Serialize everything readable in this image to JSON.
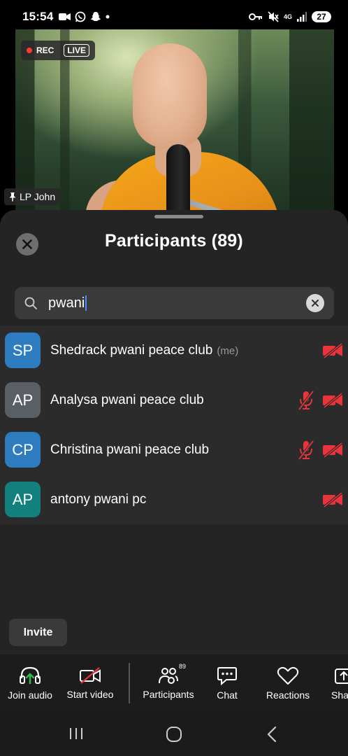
{
  "status_bar": {
    "time": "15:54",
    "network_label": "4G",
    "battery": "27"
  },
  "video": {
    "rec_label": "REC",
    "live_label": "LIVE",
    "speaker_name": "LP John"
  },
  "sheet": {
    "title": "Participants (89)",
    "search": {
      "value": "pwani"
    },
    "participants": [
      {
        "initials": "SP",
        "name": "Shedrack pwani peace club",
        "tag": "(me)",
        "color": "#2d7cbf",
        "mic_muted": false,
        "video_off": true
      },
      {
        "initials": "AP",
        "name": "Analysa pwani peace club",
        "tag": "",
        "color": "#5a5f66",
        "mic_muted": true,
        "video_off": true
      },
      {
        "initials": "CP",
        "name": "Christina pwani peace club",
        "tag": "",
        "color": "#2d7cbf",
        "mic_muted": true,
        "video_off": true
      },
      {
        "initials": "AP",
        "name": "antony pwani pc",
        "tag": "",
        "color": "#12807d",
        "mic_muted": false,
        "video_off": true
      }
    ],
    "invite_label": "Invite"
  },
  "toolbar": {
    "join_audio": "Join audio",
    "start_video": "Start video",
    "participants": "Participants",
    "participants_count": "89",
    "chat": "Chat",
    "reactions": "Reactions",
    "share": "Sha"
  },
  "colors": {
    "muted_red": "#e8343b",
    "join_audio_green": "#2dbb4f",
    "sheet_bg": "#242424"
  }
}
